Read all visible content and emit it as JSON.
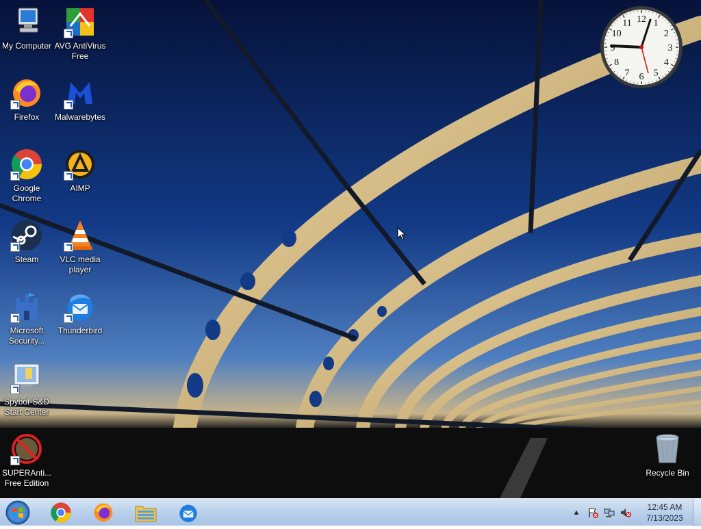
{
  "desktop_icons": {
    "my_computer": "My Computer",
    "avg": "AVG AntiVirus Free",
    "firefox": "Firefox",
    "malwarebytes": "Malwarebytes",
    "chrome": "Google Chrome",
    "aimp": "AIMP",
    "steam": "Steam",
    "vlc": "VLC media player",
    "mssecurity": "Microsoft Security...",
    "thunderbird": "Thunderbird",
    "spybot": "Spybot-S&D Start Center",
    "superanti": "SUPERAnti... Free Edition",
    "recycle_bin": "Recycle Bin"
  },
  "clock_gadget": {
    "numerals": [
      "12",
      "1",
      "2",
      "3",
      "4",
      "5",
      "6",
      "7",
      "8",
      "9",
      "10",
      "11"
    ]
  },
  "taskbar": {
    "pinned_apps": [
      "Google Chrome",
      "Firefox",
      "Windows Explorer",
      "Thunderbird"
    ]
  },
  "tray": {
    "icons": [
      "show-hidden-icons",
      "action-center-flag",
      "network",
      "volume-muted"
    ],
    "time": "12:45 AM",
    "date": "7/13/2023"
  },
  "colors": {
    "sky_top": "#0a1a4a",
    "bridge_glow": "#e8c98a",
    "taskbar": "#bcd2ec"
  }
}
